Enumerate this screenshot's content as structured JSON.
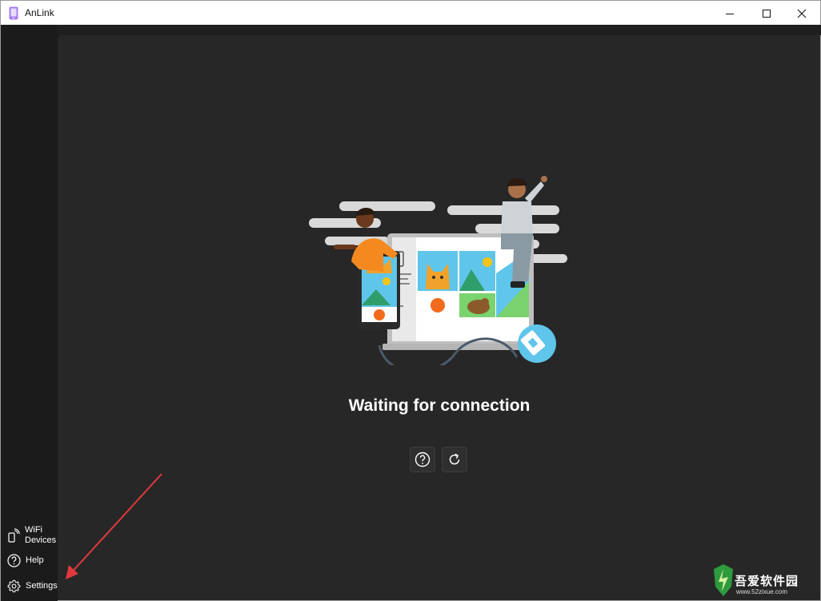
{
  "window": {
    "title": "AnLink",
    "accent": "#9b5cf6"
  },
  "sidebar": {
    "items": [
      {
        "label_line1": "WiFi",
        "label_line2": "Devices",
        "icon": "wifi-phone-icon"
      },
      {
        "label": "Help",
        "icon": "help-icon"
      },
      {
        "label": "Settings",
        "icon": "gear-icon"
      }
    ]
  },
  "main": {
    "status_text": "Waiting for connection",
    "actions": [
      {
        "icon": "help-circle-icon"
      },
      {
        "icon": "refresh-icon"
      }
    ]
  },
  "watermark": {
    "text": "吾爱软件园",
    "url": "www.52zixue.com"
  }
}
